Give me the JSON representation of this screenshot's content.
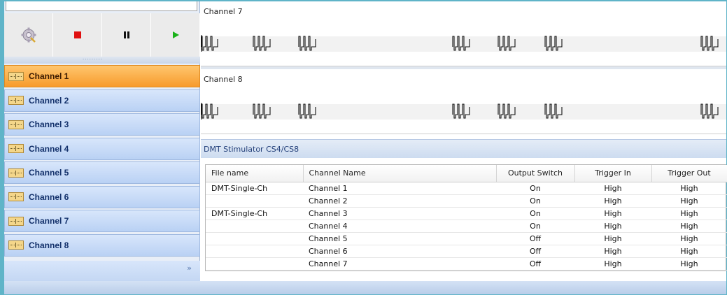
{
  "toolbar": {
    "buttons": [
      {
        "name": "settings",
        "icon": "gear-icon"
      },
      {
        "name": "stop",
        "icon": "stop-icon",
        "color": "#e01010"
      },
      {
        "name": "pause",
        "icon": "pause-icon",
        "color": "#111111"
      },
      {
        "name": "play",
        "icon": "play-icon",
        "color": "#19b219"
      }
    ]
  },
  "sidebar": {
    "items": [
      {
        "label": "Channel 1",
        "active": true
      },
      {
        "label": "Channel 2"
      },
      {
        "label": "Channel 3"
      },
      {
        "label": "Channel 4"
      },
      {
        "label": "Channel 5"
      },
      {
        "label": "Channel 6"
      },
      {
        "label": "Channel 7"
      },
      {
        "label": "Channel 8"
      }
    ],
    "more_glyph": "»"
  },
  "waveforms": [
    {
      "title": "Channel 7"
    },
    {
      "title": "Channel 8"
    }
  ],
  "stimulator": {
    "title": "DMT Stimulator CS4/CS8",
    "columns": [
      "File name",
      "Channel Name",
      "Output Switch",
      "Trigger In",
      "Trigger Out"
    ],
    "rows": [
      [
        "DMT-Single-Ch",
        "Channel 1",
        "On",
        "High",
        "High"
      ],
      [
        "",
        "Channel 2",
        "On",
        "High",
        "High"
      ],
      [
        "DMT-Single-Ch",
        "Channel 3",
        "On",
        "High",
        "High"
      ],
      [
        "",
        "Channel 4",
        "On",
        "High",
        "High"
      ],
      [
        "",
        "Channel 5",
        "Off",
        "High",
        "High"
      ],
      [
        "",
        "Channel 6",
        "Off",
        "High",
        "High"
      ],
      [
        "",
        "Channel 7",
        "Off",
        "High",
        "High"
      ]
    ]
  },
  "colors": {
    "frame": "#5fb4c8",
    "active_item": "#f79b2c",
    "item": "#b9d1f4"
  }
}
